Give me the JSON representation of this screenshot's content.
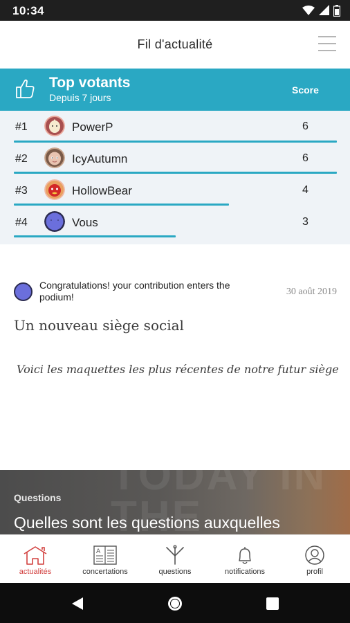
{
  "status_bar": {
    "time": "10:34"
  },
  "header": {
    "title": "Fil d'actualité"
  },
  "top_voters": {
    "title": "Top votants",
    "subtitle": "Depuis 7 jours",
    "score_label": "Score",
    "rows": [
      {
        "rank": "#1",
        "name": "PowerP",
        "score": "6",
        "share": 1.0
      },
      {
        "rank": "#2",
        "name": "IcyAutumn",
        "score": "6",
        "share": 1.0
      },
      {
        "rank": "#3",
        "name": "HollowBear",
        "score": "4",
        "share": 0.667
      },
      {
        "rank": "#4",
        "name": "Vous",
        "score": "3",
        "share": 0.5
      }
    ]
  },
  "feed": {
    "message": "Congratulations! your contribution enters the podium!",
    "date": "30 août 2019",
    "title": "Un nouveau siège social",
    "excerpt": "Voici les maquettes les plus récentes de notre futur siège"
  },
  "question_card": {
    "category": "Questions",
    "text": "Quelles sont les questions auxquelles",
    "background_text": "TODAY IN THE"
  },
  "bottom_nav": {
    "items": [
      {
        "label": "actualités",
        "icon": "house-icon",
        "active": true
      },
      {
        "label": "concertations",
        "icon": "newspaper-icon",
        "active": false
      },
      {
        "label": "questions",
        "icon": "question-fork-icon",
        "active": false
      },
      {
        "label": "notifications",
        "icon": "bell-icon",
        "active": false
      },
      {
        "label": "profil",
        "icon": "user-icon",
        "active": false
      }
    ]
  },
  "colors": {
    "accent": "#2aa8c3",
    "active_nav": "#d2403f",
    "status_bar": "#1f1f1f"
  }
}
